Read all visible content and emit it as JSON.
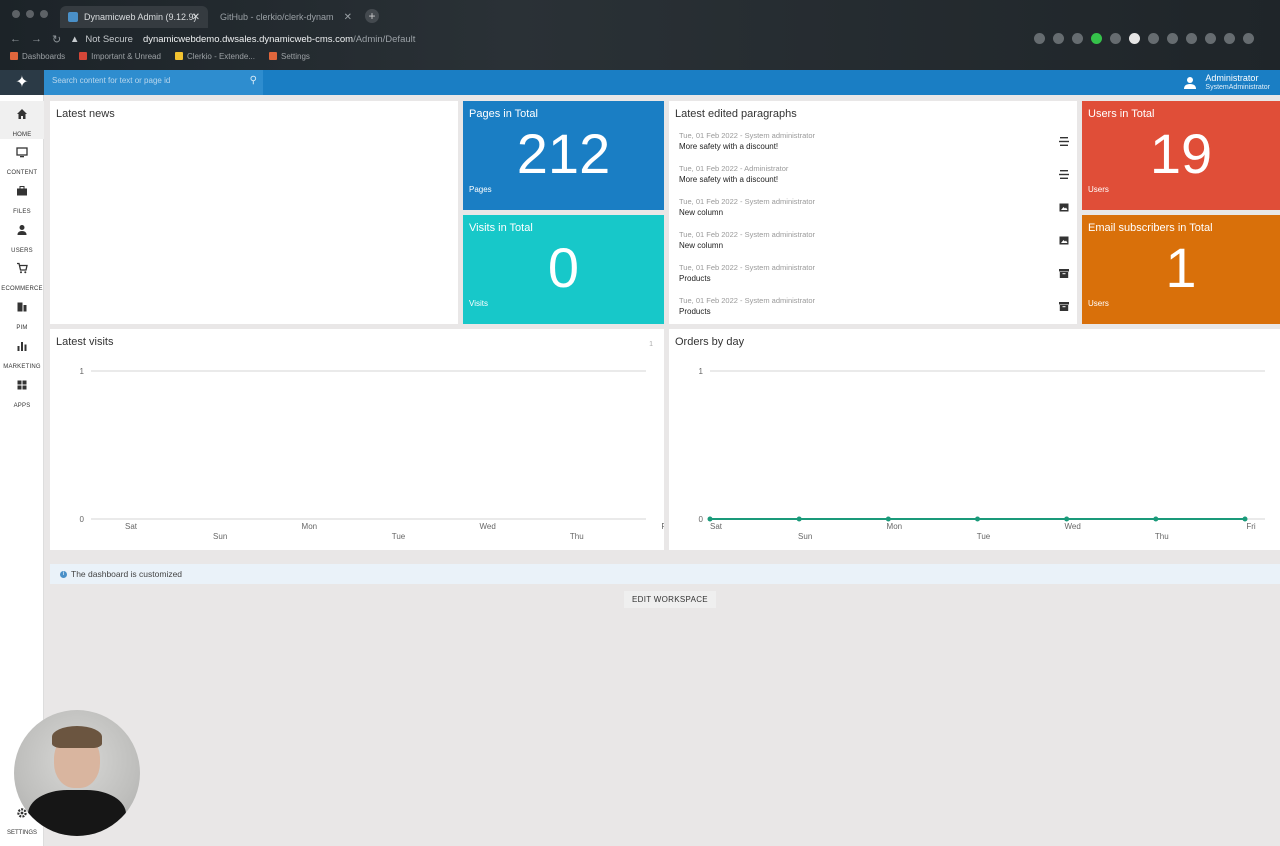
{
  "browser": {
    "tabs": [
      {
        "label": "Dynamicweb Admin (9.12.9)",
        "active": true
      },
      {
        "label": "GitHub - clerkio/clerk-dynam",
        "active": false
      }
    ],
    "security": "Not Secure",
    "url_host": "dynamicwebdemo.dwsales.dynamicweb-cms.com",
    "url_path": "/Admin/Default",
    "bookmarks": [
      "Dashboards",
      "Important & Unread",
      "Clerkio - Extende...",
      "Settings"
    ]
  },
  "topbar": {
    "search_placeholder": "Search content for text or page id",
    "user_name": "Administrator",
    "user_role": "SystemAdministrator"
  },
  "sidebar": {
    "items": [
      {
        "label": "HOME",
        "icon": "home-icon"
      },
      {
        "label": "CONTENT",
        "icon": "monitor-icon"
      },
      {
        "label": "FILES",
        "icon": "briefcase-icon"
      },
      {
        "label": "USERS",
        "icon": "person-icon"
      },
      {
        "label": "ECOMMERCE",
        "icon": "cart-icon"
      },
      {
        "label": "PIM",
        "icon": "pim-icon"
      },
      {
        "label": "MARKETING",
        "icon": "bar-chart-icon"
      },
      {
        "label": "APPS",
        "icon": "grid-icon"
      }
    ],
    "settings_label": "SETTINGS"
  },
  "cards": {
    "latest_news": {
      "title": "Latest news"
    },
    "pages": {
      "title": "Pages in Total",
      "value": "212",
      "sub": "Pages",
      "color": "#1a7ec4"
    },
    "visits": {
      "title": "Visits in Total",
      "value": "0",
      "sub": "Visits",
      "color": "#17c8c9"
    },
    "users": {
      "title": "Users in Total",
      "value": "19",
      "sub": "Users",
      "color": "#e04e38"
    },
    "subscribers": {
      "title": "Email subscribers in Total",
      "value": "1",
      "sub": "Users",
      "color": "#d9700a"
    },
    "latest_paragraphs": {
      "title": "Latest edited paragraphs",
      "items": [
        {
          "meta": "Tue, 01 Feb 2022 - System administrator",
          "name": "More safety with a discount!",
          "icon": "paragraph-icon"
        },
        {
          "meta": "Tue, 01 Feb 2022 - Administrator",
          "name": "More safety with a discount!",
          "icon": "paragraph-icon"
        },
        {
          "meta": "Tue, 01 Feb 2022 - System administrator",
          "name": "New column",
          "icon": "image-icon"
        },
        {
          "meta": "Tue, 01 Feb 2022 - System administrator",
          "name": "New column",
          "icon": "image-icon"
        },
        {
          "meta": "Tue, 01 Feb 2022 - System administrator",
          "name": "Products",
          "icon": "archive-icon"
        },
        {
          "meta": "Tue, 01 Feb 2022 - System administrator",
          "name": "Products",
          "icon": "archive-icon"
        }
      ]
    },
    "latest_visits": {
      "title": "Latest visits",
      "corner": "1"
    },
    "orders_by_day": {
      "title": "Orders by day"
    }
  },
  "chart_data": [
    {
      "type": "line",
      "title": "Latest visits",
      "categories": [
        "Sat",
        "Sun",
        "Mon",
        "Tue",
        "Wed",
        "Thu",
        "Fri"
      ],
      "series": [],
      "ylim": [
        0,
        1
      ],
      "yticks": [
        "1",
        "0"
      ],
      "grid": true
    },
    {
      "type": "line",
      "title": "Orders by day",
      "categories": [
        "Sat",
        "Sun",
        "Mon",
        "Tue",
        "Wed",
        "Thu",
        "Fri"
      ],
      "series": [
        {
          "values": [
            0,
            0,
            0,
            0,
            0,
            0,
            0
          ],
          "color": "#1a9a7a"
        }
      ],
      "ylim": [
        0,
        1
      ],
      "yticks": [
        "1",
        "0"
      ],
      "grid": true
    }
  ],
  "info": {
    "text": "The dashboard is customized"
  },
  "actions": {
    "edit_workspace": "EDIT WORKSPACE"
  }
}
